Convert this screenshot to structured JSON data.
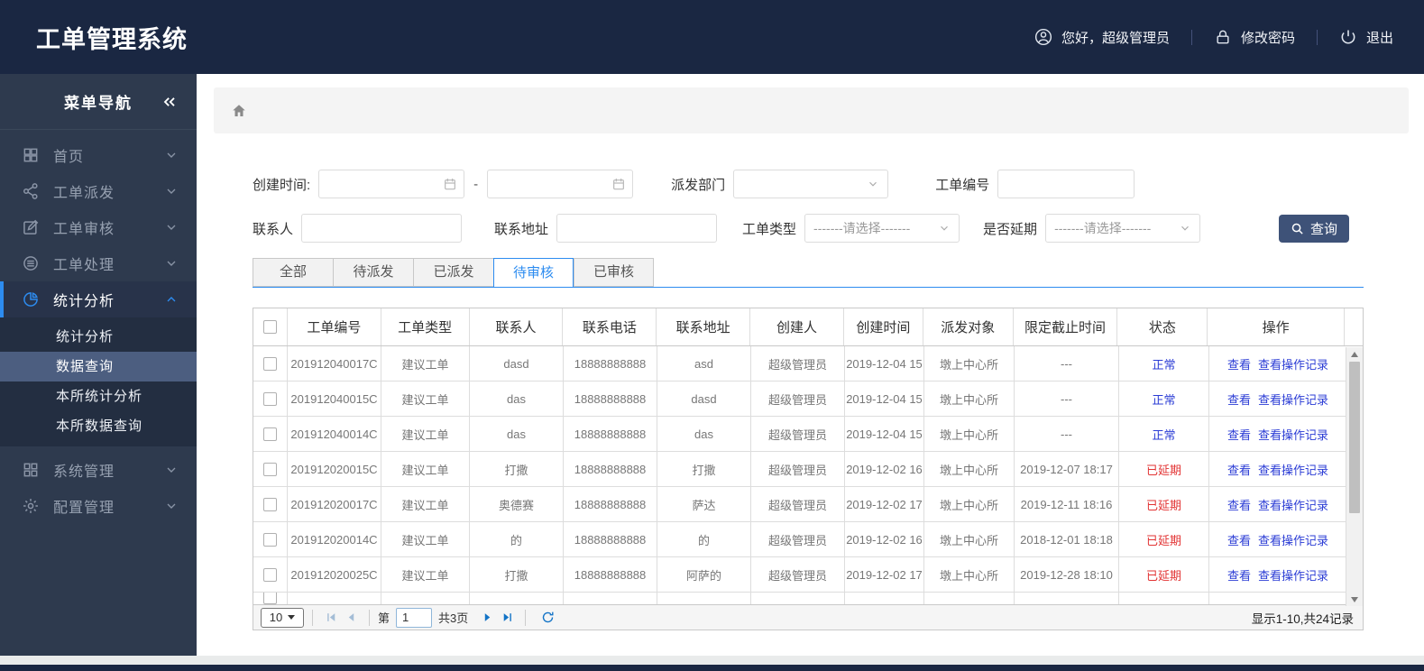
{
  "header": {
    "title": "工单管理系统",
    "greeting": "您好，超级管理员",
    "greeting_icon": "user-icon",
    "change_password": "修改密码",
    "change_password_icon": "lock-icon",
    "logout": "退出",
    "logout_icon": "power-icon"
  },
  "sidebar": {
    "title": "菜单导航",
    "collapse_icon": "double-chevron-left-icon",
    "items": [
      {
        "label": "首页",
        "icon": "grid-icon",
        "chevron": "chevron-down-icon"
      },
      {
        "label": "工单派发",
        "icon": "share-icon",
        "chevron": "chevron-down-icon"
      },
      {
        "label": "工单审核",
        "icon": "edit-icon",
        "chevron": "chevron-down-icon"
      },
      {
        "label": "工单处理",
        "icon": "database-icon",
        "chevron": "chevron-down-icon"
      },
      {
        "label": "统计分析",
        "icon": "pie-chart-icon",
        "chevron": "chevron-up-icon",
        "active": true,
        "expanded": true,
        "children": [
          {
            "label": "统计分析"
          },
          {
            "label": "数据查询",
            "active": true
          },
          {
            "label": "本所统计分析"
          },
          {
            "label": "本所数据查询"
          }
        ]
      },
      {
        "label": "系统管理",
        "icon": "modules-icon",
        "chevron": "chevron-down-icon"
      },
      {
        "label": "配置管理",
        "icon": "gear-icon",
        "chevron": "chevron-down-icon"
      }
    ]
  },
  "breadcrumb": {
    "home_icon": "home-icon"
  },
  "filters": {
    "created_time_label": "创建时间:",
    "created_time_start_value": "",
    "range_separator": "-",
    "created_time_end_value": "",
    "calendar_icon": "calendar-icon",
    "dispatch_dept_label": "派发部门",
    "dispatch_dept_value": "",
    "order_no_label": "工单编号",
    "order_no_value": "",
    "contact_label": "联系人",
    "contact_value": "",
    "address_label": "联系地址",
    "address_value": "",
    "order_type_label": "工单类型",
    "order_type_placeholder": "-------请选择-------",
    "overdue_label": "是否延期",
    "overdue_placeholder": "-------请选择-------",
    "search_button": "查询",
    "search_icon": "search-icon"
  },
  "tabs": [
    {
      "label": "全部"
    },
    {
      "label": "待派发"
    },
    {
      "label": "已派发"
    },
    {
      "label": "待审核",
      "active": true
    },
    {
      "label": "已审核"
    }
  ],
  "table": {
    "columns": [
      "工单编号",
      "工单类型",
      "联系人",
      "联系电话",
      "联系地址",
      "创建人",
      "创建时间",
      "派发对象",
      "限定截止时间",
      "状态",
      "操作"
    ],
    "action_labels": [
      "查看",
      "查看操作记录"
    ],
    "rows": [
      {
        "order_no": "201912040017C",
        "type": "建议工单",
        "contact": "dasd",
        "phone": "18888888888",
        "address": "asd",
        "creator": "超级管理员",
        "created": "2019-12-04 15",
        "target": "墩上中心所",
        "deadline": "---",
        "status": "正常",
        "status_type": "normal"
      },
      {
        "order_no": "201912040015C",
        "type": "建议工单",
        "contact": "das",
        "phone": "18888888888",
        "address": "dasd",
        "creator": "超级管理员",
        "created": "2019-12-04 15",
        "target": "墩上中心所",
        "deadline": "---",
        "status": "正常",
        "status_type": "normal"
      },
      {
        "order_no": "201912040014C",
        "type": "建议工单",
        "contact": "das",
        "phone": "18888888888",
        "address": "das",
        "creator": "超级管理员",
        "created": "2019-12-04 15",
        "target": "墩上中心所",
        "deadline": "---",
        "status": "正常",
        "status_type": "normal"
      },
      {
        "order_no": "201912020015C",
        "type": "建议工单",
        "contact": "打撒",
        "phone": "18888888888",
        "address": "打撒",
        "creator": "超级管理员",
        "created": "2019-12-02 16",
        "target": "墩上中心所",
        "deadline": "2019-12-07 18:17",
        "status": "已延期",
        "status_type": "overdue"
      },
      {
        "order_no": "201912020017C",
        "type": "建议工单",
        "contact": "奥德赛",
        "phone": "18888888888",
        "address": "萨达",
        "creator": "超级管理员",
        "created": "2019-12-02 17",
        "target": "墩上中心所",
        "deadline": "2019-12-11 18:16",
        "status": "已延期",
        "status_type": "overdue"
      },
      {
        "order_no": "201912020014C",
        "type": "建议工单",
        "contact": "的",
        "phone": "18888888888",
        "address": "的",
        "creator": "超级管理员",
        "created": "2019-12-02 16",
        "target": "墩上中心所",
        "deadline": "2018-12-01 18:18",
        "status": "已延期",
        "status_type": "overdue"
      },
      {
        "order_no": "201912020025C",
        "type": "建议工单",
        "contact": "打撒",
        "phone": "18888888888",
        "address": "阿萨的",
        "creator": "超级管理员",
        "created": "2019-12-02 17",
        "target": "墩上中心所",
        "deadline": "2019-12-28 18:10",
        "status": "已延期",
        "status_type": "overdue"
      }
    ]
  },
  "pagination": {
    "page_size": "10",
    "first_icon": "first-page-icon",
    "prev_icon": "prev-page-icon",
    "page_prefix": "第",
    "current_page": "1",
    "total_pages": "共3页",
    "next_icon": "next-page-icon",
    "last_icon": "last-page-icon",
    "refresh_icon": "refresh-icon",
    "summary": "显示1-10,共24记录"
  }
}
